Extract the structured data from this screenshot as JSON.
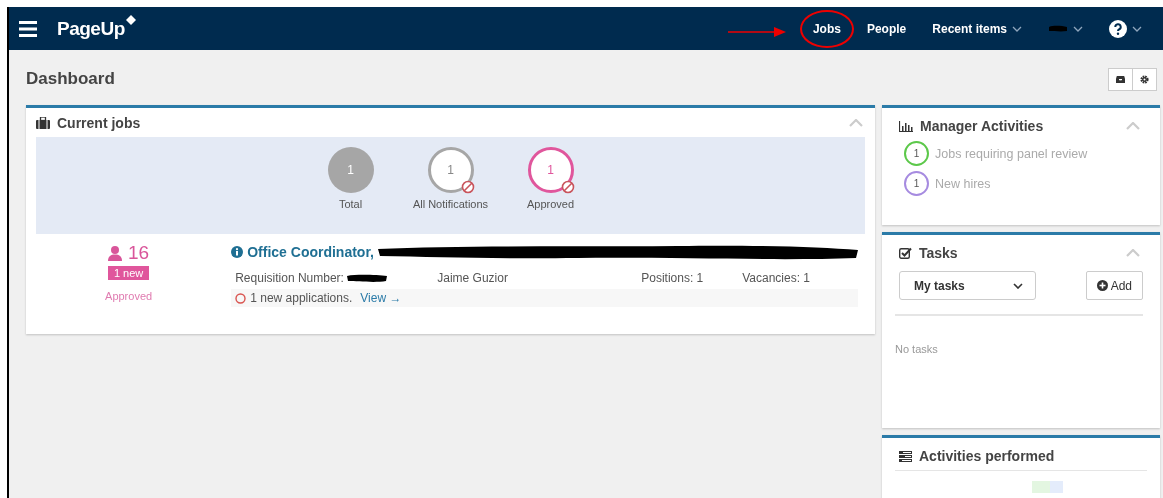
{
  "nav": {
    "brand": "PageUp",
    "items": [
      {
        "kind": "link",
        "label": "Jobs",
        "highlighted": true
      },
      {
        "kind": "link",
        "label": "People",
        "highlighted": false
      },
      {
        "kind": "dropdown",
        "label": "Recent items",
        "highlighted": false
      },
      {
        "kind": "redacted",
        "highlighted": false
      },
      {
        "kind": "help",
        "highlighted": false
      }
    ]
  },
  "page": {
    "title": "Dashboard"
  },
  "current_jobs": {
    "title": "Current jobs",
    "summary": [
      {
        "kind": "solid",
        "count": "1",
        "label": "Total",
        "color": "#a6a6a6"
      },
      {
        "kind": "ring",
        "count": "1",
        "label": "All Notifications",
        "color": "#a6a6a6"
      },
      {
        "kind": "ring",
        "count": "1",
        "label": "Approved",
        "color": "#e0569c"
      }
    ],
    "job": {
      "applicants": "16",
      "new_badge": "1 new",
      "status": "Approved",
      "title": "Office Coordinator,",
      "title_redacted": true,
      "requisition_label": "Requisition Number:",
      "requisition_redacted": true,
      "recruiter": "Jaime Guzior",
      "positions": "Positions: 1",
      "vacancies": "Vacancies: 1",
      "notice": "1 new applications.",
      "notice_link": "View →"
    }
  },
  "manager_activities": {
    "title": "Manager Activities",
    "items": [
      {
        "count": "1",
        "label": "Jobs requiring panel review",
        "color": "#5cc84a"
      },
      {
        "count": "1",
        "label": "New hires",
        "color": "#a68be0"
      }
    ]
  },
  "tasks": {
    "title": "Tasks",
    "filter": "My tasks",
    "add": "Add",
    "empty": "No tasks"
  },
  "activities_performed": {
    "title": "Activities performed"
  }
}
